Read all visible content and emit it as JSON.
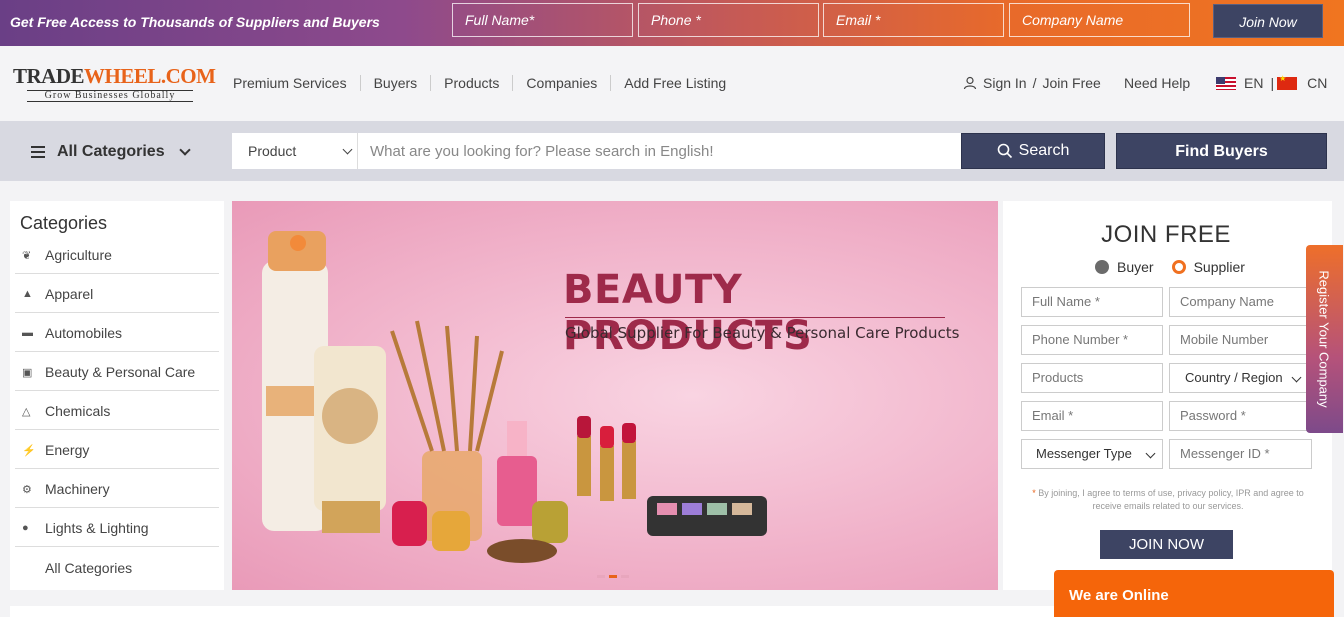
{
  "promo": {
    "text": "Get Free Access to Thousands of Suppliers and Buyers",
    "fields": [
      "Full Name*",
      "Phone *",
      "Email *",
      "Company Name"
    ],
    "join_label": "Join Now"
  },
  "header": {
    "logo_left": "TRADE",
    "logo_right": "WHEEL.COM",
    "tagline": "Grow Businesses Globally",
    "nav": [
      "Premium Services",
      "Buyers",
      "Products",
      "Companies",
      "Add Free Listing"
    ],
    "sign_in": "Sign In",
    "separator": "/",
    "join_free": "Join Free",
    "need_help": "Need Help",
    "lang_en": "EN",
    "lang_sep": "|",
    "lang_cn": "CN"
  },
  "searchbar": {
    "all_categories": "All Categories",
    "type_selected": "Product",
    "placeholder": "What are you looking for? Please search in English!",
    "search_label": "Search",
    "find_buyers_label": "Find Buyers"
  },
  "categories": {
    "title": "Categories",
    "items": [
      {
        "label": "Agriculture",
        "icon": "leaf-icon"
      },
      {
        "label": "Apparel",
        "icon": "shirt-icon"
      },
      {
        "label": "Automobiles",
        "icon": "car-icon"
      },
      {
        "label": "Beauty & Personal Care",
        "icon": "cosmetics-icon"
      },
      {
        "label": "Chemicals",
        "icon": "flask-icon"
      },
      {
        "label": "Energy",
        "icon": "bolt-icon"
      },
      {
        "label": "Machinery",
        "icon": "gear-icon"
      },
      {
        "label": "Lights & Lighting",
        "icon": "bulb-icon"
      },
      {
        "label": "All Categories",
        "icon": ""
      }
    ]
  },
  "banner": {
    "title": "BEAUTY PRODUCTS",
    "subtitle": "Global Supplier For Beauty & Personal Care Products",
    "slide_count": 3,
    "active_slide": 2
  },
  "join": {
    "title": "JOIN FREE",
    "radio_buyer": "Buyer",
    "radio_supplier": "Supplier",
    "selected_role": "Supplier",
    "fields": {
      "full_name": "Full Name *",
      "company_name": "Company Name",
      "phone": "Phone Number *",
      "mobile": "Mobile Number",
      "products": "Products",
      "country": "Country / Region",
      "email": "Email *",
      "password": "Password *",
      "messenger_type": "Messenger Type",
      "messenger_id": "Messenger ID *"
    },
    "terms_star": "*",
    "terms": "By joining, I agree to terms of use, privacy policy, IPR and agree to receive emails related to our services.",
    "button_label": "JOIN NOW"
  },
  "register_tab": "Register Your Company",
  "chat": "We are Online",
  "colors": {
    "navy": "#3d4463",
    "orange": "#f07020",
    "brand_red": "#9e2a4a"
  }
}
